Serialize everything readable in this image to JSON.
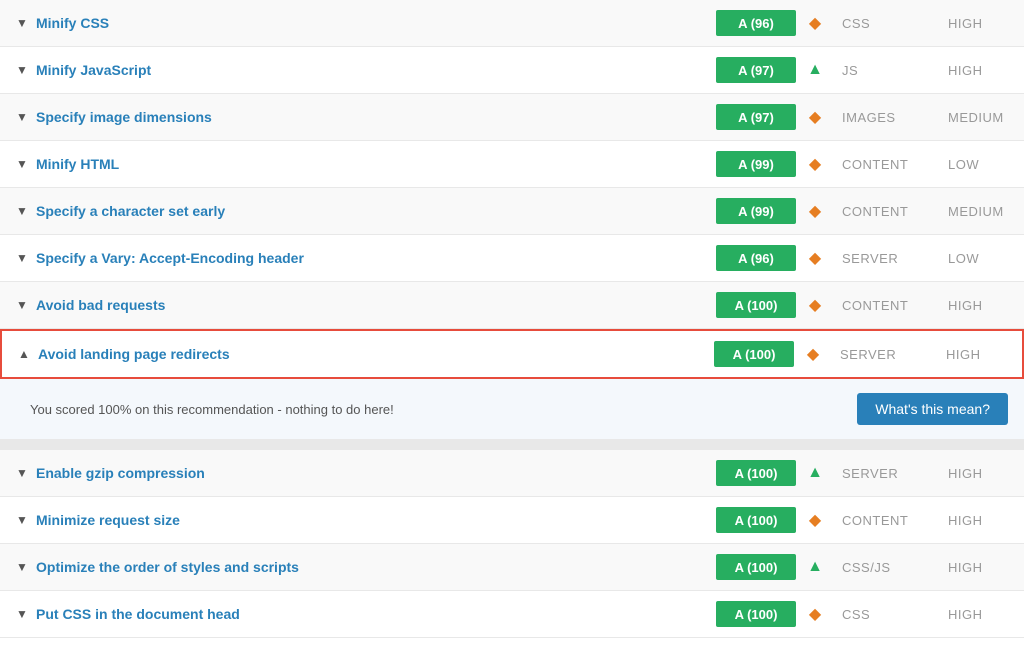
{
  "rows": [
    {
      "id": "minify-css",
      "title": "Minify CSS",
      "score": "A (96)",
      "trend": "diamond",
      "category": "CSS",
      "priority": "HIGH",
      "expanded": false
    },
    {
      "id": "minify-js",
      "title": "Minify JavaScript",
      "score": "A (97)",
      "trend": "up",
      "category": "JS",
      "priority": "HIGH",
      "expanded": false
    },
    {
      "id": "specify-image-dimensions",
      "title": "Specify image dimensions",
      "score": "A (97)",
      "trend": "diamond",
      "category": "IMAGES",
      "priority": "MEDIUM",
      "expanded": false
    },
    {
      "id": "minify-html",
      "title": "Minify HTML",
      "score": "A (99)",
      "trend": "diamond",
      "category": "CONTENT",
      "priority": "LOW",
      "expanded": false
    },
    {
      "id": "specify-charset",
      "title": "Specify a character set early",
      "score": "A (99)",
      "trend": "diamond",
      "category": "CONTENT",
      "priority": "MEDIUM",
      "expanded": false
    },
    {
      "id": "vary-header",
      "title": "Specify a Vary: Accept-Encoding header",
      "score": "A (96)",
      "trend": "diamond",
      "category": "SERVER",
      "priority": "LOW",
      "expanded": false
    },
    {
      "id": "avoid-bad-requests",
      "title": "Avoid bad requests",
      "score": "A (100)",
      "trend": "diamond",
      "category": "CONTENT",
      "priority": "HIGH",
      "expanded": false
    },
    {
      "id": "avoid-landing-redirects",
      "title": "Avoid landing page redirects",
      "score": "A (100)",
      "trend": "diamond",
      "category": "SERVER",
      "priority": "HIGH",
      "expanded": true,
      "detail": "You scored 100% on this recommendation - nothing to do here!",
      "detail_button": "What's this mean?"
    }
  ],
  "rows2": [
    {
      "id": "enable-gzip",
      "title": "Enable gzip compression",
      "score": "A (100)",
      "trend": "up",
      "category": "SERVER",
      "priority": "HIGH",
      "expanded": false
    },
    {
      "id": "minimize-request-size",
      "title": "Minimize request size",
      "score": "A (100)",
      "trend": "diamond",
      "category": "CONTENT",
      "priority": "HIGH",
      "expanded": false
    },
    {
      "id": "order-of-styles",
      "title": "Optimize the order of styles and scripts",
      "score": "A (100)",
      "trend": "up",
      "category": "CSS/JS",
      "priority": "HIGH",
      "expanded": false
    },
    {
      "id": "css-in-head",
      "title": "Put CSS in the document head",
      "score": "A (100)",
      "trend": "diamond",
      "category": "CSS",
      "priority": "HIGH",
      "expanded": false
    }
  ],
  "icons": {
    "arrow_down": "▼",
    "arrow_up": "▲",
    "diamond": "◆",
    "trend_up": "▲"
  }
}
